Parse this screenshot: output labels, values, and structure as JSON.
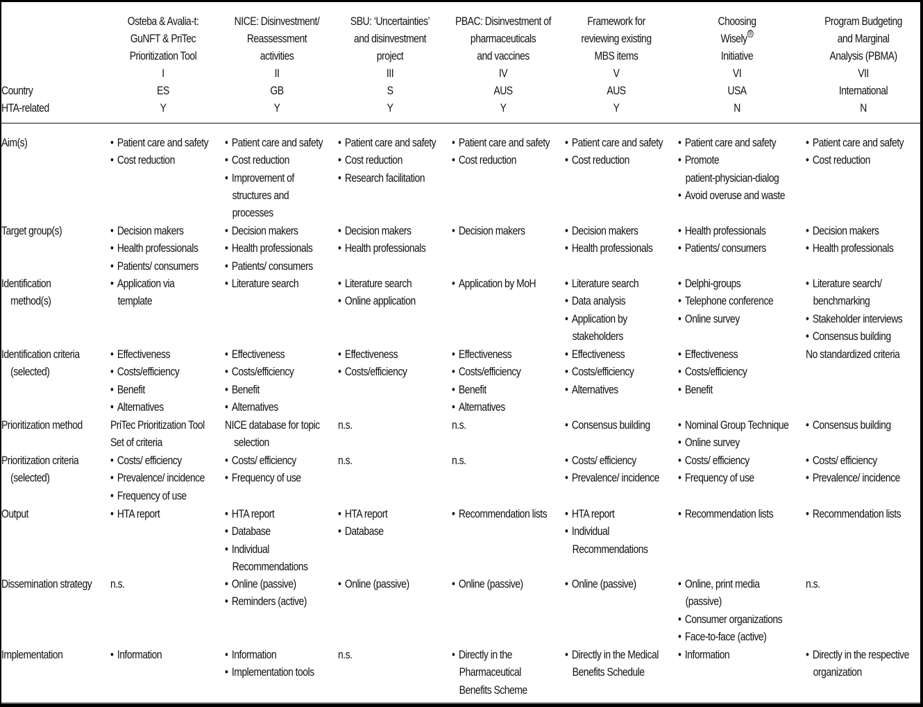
{
  "table": {
    "row_header_labels": {
      "country": "Country",
      "hta_related": "HTA-related"
    },
    "columns": [
      {
        "title_lines": [
          "Osteba & Avalia-t:",
          "GuNFT & PriTec",
          "Prioritization Tool"
        ],
        "numeral": "I",
        "country": "ES",
        "hta_related": "Y"
      },
      {
        "title_lines": [
          "NICE: Disinvestment/",
          "Reassessment",
          "activities"
        ],
        "numeral": "II",
        "country": "GB",
        "hta_related": "Y"
      },
      {
        "title_lines": [
          "SBU: ‘Uncertainties’",
          "and disinvestment",
          "project"
        ],
        "numeral": "III",
        "country": "S",
        "hta_related": "Y"
      },
      {
        "title_lines": [
          "PBAC: Disinvestment of",
          "pharmaceuticals",
          "and vaccines"
        ],
        "numeral": "IV",
        "country": "AUS",
        "hta_related": "Y"
      },
      {
        "title_lines": [
          "Framework for",
          "reviewing existing",
          "MBS items"
        ],
        "numeral": "V",
        "country": "AUS",
        "hta_related": "Y"
      },
      {
        "title_lines": [
          "Choosing",
          "Wisely",
          "Initiative"
        ],
        "title_mark": "®",
        "numeral": "VI",
        "country": "USA",
        "hta_related": "N"
      },
      {
        "title_lines": [
          "Program Budgeting",
          "and Marginal",
          "Analysis (PBMA)"
        ],
        "numeral": "VII",
        "country": "International",
        "hta_related": "N"
      }
    ],
    "rows": [
      {
        "label_lines": [
          "Aim(s)"
        ],
        "cells": [
          {
            "bullets": [
              [
                "Patient care and safety"
              ],
              [
                "Cost reduction"
              ]
            ]
          },
          {
            "bullets": [
              [
                "Patient care and safety"
              ],
              [
                "Cost reduction"
              ],
              [
                "Improvement of",
                "structures and",
                "processes"
              ]
            ]
          },
          {
            "bullets": [
              [
                "Patient care and safety"
              ],
              [
                "Cost reduction"
              ],
              [
                "Research facilitation"
              ]
            ]
          },
          {
            "bullets": [
              [
                "Patient care and safety"
              ],
              [
                "Cost reduction"
              ]
            ]
          },
          {
            "bullets": [
              [
                "Patient care and safety"
              ],
              [
                "Cost reduction"
              ]
            ]
          },
          {
            "bullets": [
              [
                "Patient care and safety"
              ],
              [
                "Promote",
                "patient-physician-dialog"
              ],
              [
                "Avoid overuse and waste"
              ]
            ]
          },
          {
            "bullets": [
              [
                "Patient care and safety"
              ],
              [
                "Cost reduction"
              ]
            ]
          }
        ]
      },
      {
        "label_lines": [
          "Target group(s)"
        ],
        "cells": [
          {
            "bullets": [
              [
                "Decision makers"
              ],
              [
                "Health professionals"
              ],
              [
                "Patients/ consumers"
              ]
            ]
          },
          {
            "bullets": [
              [
                "Decision makers"
              ],
              [
                "Health professionals"
              ],
              [
                "Patients/ consumers"
              ]
            ]
          },
          {
            "bullets": [
              [
                "Decision makers"
              ],
              [
                "Health professionals"
              ]
            ]
          },
          {
            "bullets": [
              [
                "Decision makers"
              ]
            ]
          },
          {
            "bullets": [
              [
                "Decision makers"
              ],
              [
                "Health professionals"
              ]
            ]
          },
          {
            "bullets": [
              [
                "Health professionals"
              ],
              [
                "Patients/ consumers"
              ]
            ]
          },
          {
            "bullets": [
              [
                "Decision makers"
              ],
              [
                "Health professionals"
              ]
            ]
          }
        ]
      },
      {
        "label_lines": [
          "Identification",
          "method(s)"
        ],
        "cells": [
          {
            "bullets": [
              [
                "Application via",
                "template"
              ]
            ]
          },
          {
            "bullets": [
              [
                "Literature search"
              ]
            ]
          },
          {
            "bullets": [
              [
                "Literature search"
              ],
              [
                "Online application"
              ]
            ]
          },
          {
            "bullets": [
              [
                "Application by MoH"
              ]
            ]
          },
          {
            "bullets": [
              [
                "Literature search"
              ],
              [
                "Data analysis"
              ],
              [
                "Application by",
                "stakeholders"
              ]
            ]
          },
          {
            "bullets": [
              [
                "Delphi-groups"
              ],
              [
                "Telephone conference"
              ],
              [
                "Online survey"
              ]
            ]
          },
          {
            "bullets": [
              [
                "Literature search/",
                "benchmarking"
              ],
              [
                "Stakeholder interviews"
              ],
              [
                "Consensus building"
              ]
            ]
          }
        ]
      },
      {
        "label_lines": [
          "Identification criteria",
          "(selected)"
        ],
        "cells": [
          {
            "bullets": [
              [
                "Effectiveness"
              ],
              [
                "Costs/efficiency"
              ],
              [
                "Benefit"
              ],
              [
                "Alternatives"
              ]
            ]
          },
          {
            "bullets": [
              [
                "Effectiveness"
              ],
              [
                "Costs/efficiency"
              ],
              [
                "Benefit"
              ],
              [
                "Alternatives"
              ]
            ]
          },
          {
            "bullets": [
              [
                "Effectiveness"
              ],
              [
                "Costs/efficiency"
              ]
            ]
          },
          {
            "bullets": [
              [
                "Effectiveness"
              ],
              [
                "Costs/efficiency"
              ],
              [
                "Benefit"
              ],
              [
                "Alternatives"
              ]
            ]
          },
          {
            "bullets": [
              [
                "Effectiveness"
              ],
              [
                "Costs/efficiency"
              ],
              [
                "Alternatives"
              ]
            ]
          },
          {
            "bullets": [
              [
                "Effectiveness"
              ],
              [
                "Costs/efficiency"
              ],
              [
                "Benefit"
              ]
            ]
          },
          {
            "plain": [
              [
                "No standardized criteria"
              ]
            ]
          }
        ]
      },
      {
        "label_lines": [
          "Prioritization method"
        ],
        "cells": [
          {
            "plain": [
              [
                "PriTec Prioritization Tool"
              ],
              [
                "Set of criteria"
              ]
            ]
          },
          {
            "plain": [
              [
                "NICE database for topic",
                "selection"
              ]
            ]
          },
          {
            "plain": [
              [
                "n.s."
              ]
            ]
          },
          {
            "plain": [
              [
                "n.s."
              ]
            ]
          },
          {
            "bullets": [
              [
                "Consensus building"
              ]
            ]
          },
          {
            "bullets": [
              [
                "Nominal Group Technique"
              ],
              [
                "Online survey"
              ]
            ]
          },
          {
            "bullets": [
              [
                "Consensus building"
              ]
            ]
          }
        ]
      },
      {
        "label_lines": [
          "Prioritization criteria",
          "(selected)"
        ],
        "cells": [
          {
            "bullets": [
              [
                "Costs/ efficiency"
              ],
              [
                "Prevalence/ incidence"
              ],
              [
                "Frequency of use"
              ]
            ]
          },
          {
            "bullets": [
              [
                "Costs/ efficiency"
              ],
              [
                "Frequency of use"
              ]
            ]
          },
          {
            "plain": [
              [
                "n.s."
              ]
            ]
          },
          {
            "plain": [
              [
                "n.s."
              ]
            ]
          },
          {
            "bullets": [
              [
                "Costs/ efficiency"
              ],
              [
                "Prevalence/ incidence"
              ]
            ]
          },
          {
            "bullets": [
              [
                "Costs/ efficiency"
              ],
              [
                "Frequency of use"
              ]
            ]
          },
          {
            "bullets": [
              [
                "Costs/ efficiency"
              ],
              [
                "Prevalence/ incidence"
              ]
            ]
          }
        ]
      },
      {
        "label_lines": [
          "Output"
        ],
        "cells": [
          {
            "bullets": [
              [
                "HTA report"
              ]
            ]
          },
          {
            "bullets": [
              [
                "HTA report"
              ],
              [
                "Database"
              ],
              [
                "Individual",
                "Recommendations"
              ]
            ]
          },
          {
            "bullets": [
              [
                "HTA report"
              ],
              [
                "Database"
              ]
            ]
          },
          {
            "bullets": [
              [
                "Recommendation lists"
              ]
            ]
          },
          {
            "bullets": [
              [
                "HTA report"
              ],
              [
                "Individual",
                "Recommendations"
              ]
            ]
          },
          {
            "bullets": [
              [
                "Recommendation lists"
              ]
            ]
          },
          {
            "bullets": [
              [
                "Recommendation lists"
              ]
            ]
          }
        ]
      },
      {
        "label_lines": [
          "Dissemination strategy"
        ],
        "cells": [
          {
            "plain": [
              [
                "n.s."
              ]
            ]
          },
          {
            "bullets": [
              [
                "Online (passive)"
              ],
              [
                "Reminders (active)"
              ]
            ]
          },
          {
            "bullets": [
              [
                "Online (passive)"
              ]
            ]
          },
          {
            "bullets": [
              [
                "Online (passive)"
              ]
            ]
          },
          {
            "bullets": [
              [
                "Online (passive)"
              ]
            ]
          },
          {
            "bullets": [
              [
                "Online, print media",
                "(passive)"
              ],
              [
                "Consumer organizations"
              ],
              [
                "Face-to-face (active)"
              ]
            ]
          },
          {
            "plain": [
              [
                "n.s."
              ]
            ]
          }
        ]
      },
      {
        "label_lines": [
          "Implementation"
        ],
        "cells": [
          {
            "bullets": [
              [
                "Information"
              ]
            ]
          },
          {
            "bullets": [
              [
                "Information"
              ],
              [
                "Implementation tools"
              ]
            ]
          },
          {
            "plain": [
              [
                "n.s."
              ]
            ]
          },
          {
            "bullets": [
              [
                "Directly in the",
                "Pharmaceutical",
                "Benefits Scheme"
              ]
            ]
          },
          {
            "bullets": [
              [
                "Directly in the Medical",
                "Benefits Schedule"
              ]
            ]
          },
          {
            "bullets": [
              [
                "Information"
              ]
            ]
          },
          {
            "bullets": [
              [
                "Directly in the respective",
                "organization"
              ]
            ]
          }
        ]
      }
    ]
  }
}
